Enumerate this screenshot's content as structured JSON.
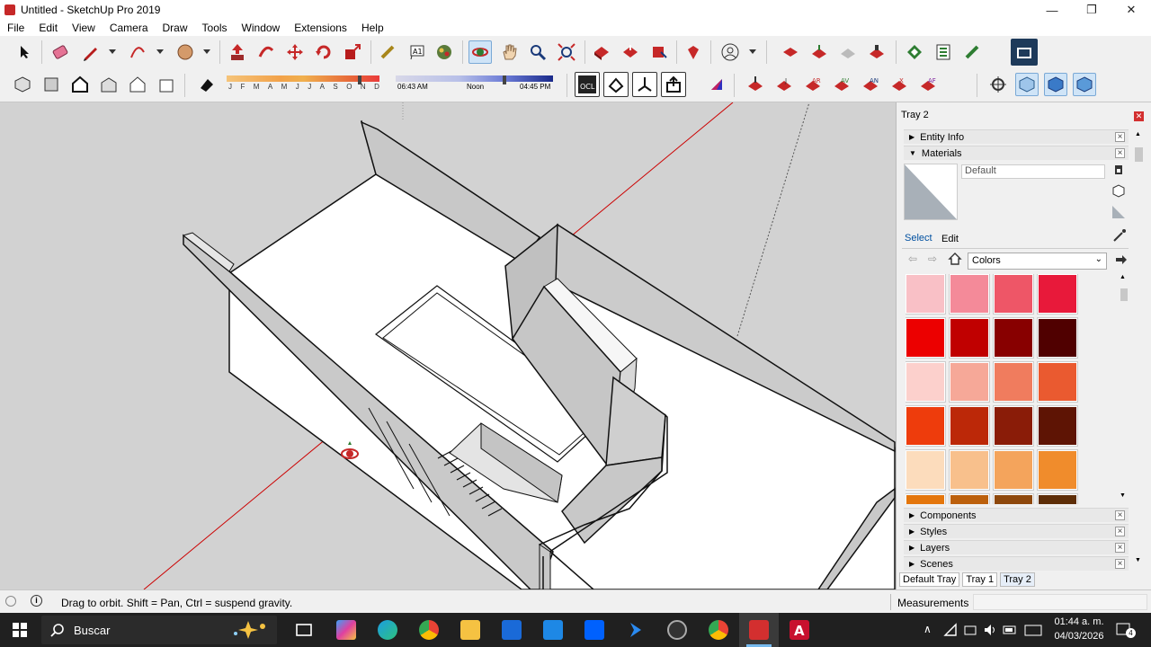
{
  "window": {
    "title": "Untitled - SketchUp Pro 2019",
    "minimize": "—",
    "maximize": "❐",
    "close": "✕"
  },
  "menu": [
    "File",
    "Edit",
    "View",
    "Camera",
    "Draw",
    "Tools",
    "Window",
    "Extensions",
    "Help"
  ],
  "shadows": {
    "months": [
      "J",
      "F",
      "M",
      "A",
      "M",
      "J",
      "J",
      "A",
      "S",
      "O",
      "N",
      "D"
    ],
    "time_start": "06:43 AM",
    "time_mid": "Noon",
    "time_end": "04:45 PM"
  },
  "tray": {
    "title": "Tray 2",
    "panels_top": [
      {
        "label": "Entity Info",
        "expanded": false
      },
      {
        "label": "Materials",
        "expanded": true
      }
    ],
    "material_name": "Default",
    "tab_select": "Select",
    "tab_edit": "Edit",
    "library": "Colors",
    "swatches": [
      "#f9c0c6",
      "#f48a99",
      "#ee5667",
      "#e8193a",
      "#ec0000",
      "#c00000",
      "#880000",
      "#500000",
      "#fcd0cc",
      "#f6a898",
      "#f07c5e",
      "#ea5a30",
      "#ee3c0c",
      "#bc2808",
      "#8a1c08",
      "#5e1404",
      "#fcdcbc",
      "#f8c08c",
      "#f4a45c",
      "#f08c2c",
      "#e4760c",
      "#bc600c",
      "#8e480c",
      "#5e2e08"
    ],
    "panels_bottom": [
      "Components",
      "Styles",
      "Layers",
      "Scenes"
    ],
    "tabs": [
      "Default Tray",
      "Tray 1",
      "Tray 2"
    ]
  },
  "status": {
    "hint": "Drag to orbit. Shift = Pan, Ctrl = suspend gravity.",
    "measurements_label": "Measurements"
  },
  "taskbar": {
    "search_placeholder": "Buscar",
    "time": "01:44 a. m.",
    "date": "04/03/2026",
    "notifications": "4"
  },
  "colors": {
    "accent": "#0078d7",
    "axis_red": "#cc0000",
    "taskbar": "#202020"
  }
}
